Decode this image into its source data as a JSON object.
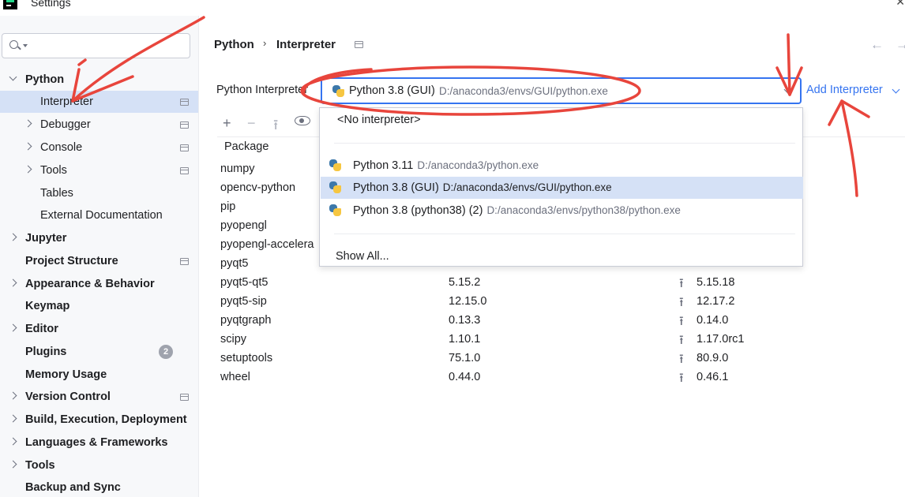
{
  "window": {
    "title": "Settings",
    "close_glyph": "✕"
  },
  "search": {
    "placeholder": ""
  },
  "sidebar": {
    "items": [
      {
        "label": "Python",
        "bold": true,
        "expand": "down",
        "indent": 0
      },
      {
        "label": "Interpreter",
        "bold": false,
        "expand": "none",
        "indent": 1,
        "selected": true,
        "icon": "project-icon"
      },
      {
        "label": "Debugger",
        "bold": false,
        "expand": "right",
        "indent": 1,
        "icon": "project-icon"
      },
      {
        "label": "Console",
        "bold": false,
        "expand": "right",
        "indent": 1,
        "icon": "project-icon"
      },
      {
        "label": "Tools",
        "bold": false,
        "expand": "right",
        "indent": 1,
        "icon": "project-icon"
      },
      {
        "label": "Tables",
        "bold": false,
        "expand": "none",
        "indent": 1
      },
      {
        "label": "External Documentation",
        "bold": false,
        "expand": "none",
        "indent": 1
      },
      {
        "label": "Jupyter",
        "bold": true,
        "expand": "right",
        "indent": 0
      },
      {
        "label": "Project Structure",
        "bold": true,
        "expand": "none",
        "indent": 0,
        "icon": "project-icon"
      },
      {
        "label": "Appearance & Behavior",
        "bold": true,
        "expand": "right",
        "indent": 0
      },
      {
        "label": "Keymap",
        "bold": true,
        "expand": "none",
        "indent": 0
      },
      {
        "label": "Editor",
        "bold": true,
        "expand": "right",
        "indent": 0
      },
      {
        "label": "Plugins",
        "bold": true,
        "expand": "none",
        "indent": 0,
        "badge": "2"
      },
      {
        "label": "Memory Usage",
        "bold": true,
        "expand": "none",
        "indent": 0
      },
      {
        "label": "Version Control",
        "bold": true,
        "expand": "right",
        "indent": 0,
        "icon": "project-icon"
      },
      {
        "label": "Build, Execution, Deployment",
        "bold": true,
        "expand": "right",
        "indent": 0
      },
      {
        "label": "Languages & Frameworks",
        "bold": true,
        "expand": "right",
        "indent": 0
      },
      {
        "label": "Tools",
        "bold": true,
        "expand": "right",
        "indent": 0
      },
      {
        "label": "Backup and Sync",
        "bold": true,
        "expand": "none",
        "indent": 0
      }
    ]
  },
  "header": {
    "crumb1": "Python",
    "crumb_sep": "›",
    "crumb2": "Interpreter",
    "back_glyph": "←",
    "forward_glyph": "→"
  },
  "interpreter": {
    "label": "Python Interpreter",
    "selected_name": "Python 3.8 (GUI)",
    "selected_path": "D:/anaconda3/envs/GUI/python.exe",
    "add_label": "Add Interpreter"
  },
  "toolbar": {
    "plus": "+",
    "minus": "−",
    "upgrade": "⭱"
  },
  "table": {
    "header_package": "Package",
    "rows": [
      {
        "name": "numpy",
        "version": "",
        "latest": ""
      },
      {
        "name": "opencv-python",
        "version": "",
        "latest": ""
      },
      {
        "name": "pip",
        "version": "",
        "latest": ""
      },
      {
        "name": "pyopengl",
        "version": "",
        "latest": ""
      },
      {
        "name": "pyopengl-accelera",
        "version": "",
        "latest": ""
      },
      {
        "name": "pyqt5",
        "version": "",
        "latest": ""
      },
      {
        "name": "pyqt5-qt5",
        "version": "5.15.2",
        "latest": "5.15.18"
      },
      {
        "name": "pyqt5-sip",
        "version": "12.15.0",
        "latest": "12.17.2"
      },
      {
        "name": "pyqtgraph",
        "version": "0.13.3",
        "latest": "0.14.0"
      },
      {
        "name": "scipy",
        "version": "1.10.1",
        "latest": "1.17.0rc1"
      },
      {
        "name": "setuptools",
        "version": "75.1.0",
        "latest": "80.9.0"
      },
      {
        "name": "wheel",
        "version": "0.44.0",
        "latest": "0.46.1"
      }
    ]
  },
  "popup": {
    "no_interpreter": "<No interpreter>",
    "items": [
      {
        "name": "Python 3.11",
        "path": "D:/anaconda3/python.exe",
        "selected": false
      },
      {
        "name": "Python 3.8 (GUI)",
        "path": "D:/anaconda3/envs/GUI/python.exe",
        "selected": true
      },
      {
        "name": "Python 3.8 (python38) (2)",
        "path": "D:/anaconda3/envs/python38/python.exe",
        "selected": false
      }
    ],
    "show_all": "Show All..."
  },
  "colors": {
    "accent": "#3574f0",
    "selection": "#d5e1f6",
    "annotation": "#e8453c"
  }
}
